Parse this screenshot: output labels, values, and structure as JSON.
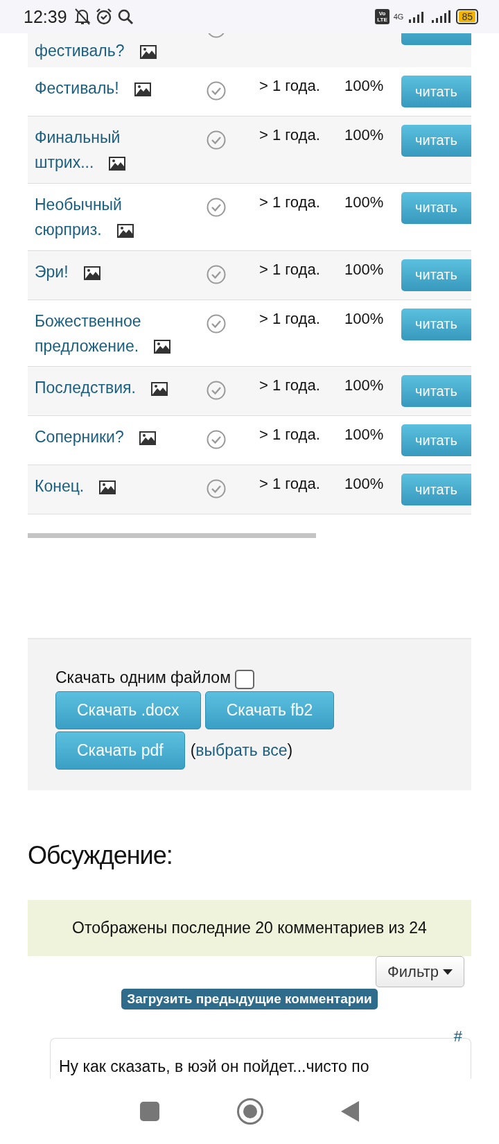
{
  "status_bar": {
    "time": "12:39",
    "battery": "85",
    "network": "4G",
    "volte": [
      "Vo",
      "LTE"
    ]
  },
  "chapters": [
    {
      "title": "фестиваль?",
      "partial": true
    },
    {
      "title": "Фестиваль!",
      "updated": "> 1 года.",
      "progress": "100%",
      "button": "читать"
    },
    {
      "title": "Финальный штрих...",
      "updated": "> 1 года.",
      "progress": "100%",
      "button": "читать"
    },
    {
      "title": "Необычный сюрприз.",
      "updated": "> 1 года.",
      "progress": "100%",
      "button": "читать"
    },
    {
      "title": "Эри!",
      "updated": "> 1 года.",
      "progress": "100%",
      "button": "читать"
    },
    {
      "title": "Божественное предложение.",
      "updated": "> 1 года.",
      "progress": "100%",
      "button": "читать"
    },
    {
      "title": "Последствия.",
      "updated": "> 1 года.",
      "progress": "100%",
      "button": "читать"
    },
    {
      "title": "Соперники?",
      "updated": "> 1 года.",
      "progress": "100%",
      "button": "читать"
    },
    {
      "title": "Конец.",
      "updated": "> 1 года.",
      "progress": "100%",
      "button": "читать"
    }
  ],
  "download": {
    "single_file_label": "Скачать одним файлом",
    "single_file_checked": false,
    "buttons": [
      "Скачать .docx",
      "Скачать fb2",
      "Скачать pdf"
    ],
    "select_all": {
      "before": "(",
      "link": "выбрать все",
      "after": ")"
    }
  },
  "discussion": {
    "heading": "Обсуждение:",
    "notice": "Отображены последние 20 комментариев из 24",
    "filter": "Фильтр",
    "load_previous": "Загрузить предыдущие комментарии",
    "comment": {
      "anchor": "#",
      "text": "Ну как сказать, в юэй он пойдет...чисто по"
    }
  }
}
